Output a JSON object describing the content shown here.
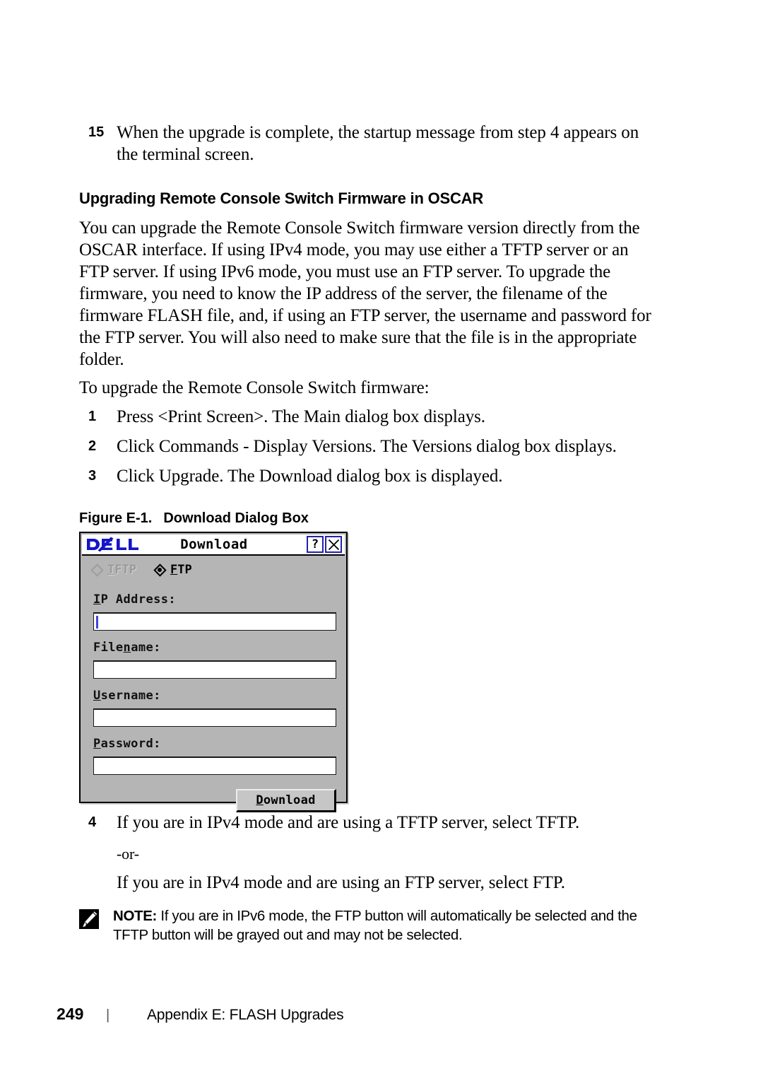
{
  "page": {
    "number": "249",
    "separator": "|",
    "footer_title": "Appendix E: FLASH Upgrades"
  },
  "step15": {
    "number": "15",
    "text": "When the upgrade is complete, the startup message from step 4 appears on the terminal screen."
  },
  "section": {
    "heading": "Upgrading Remote Console Switch Firmware in OSCAR",
    "paragraph": "You can upgrade the Remote Console Switch firmware version directly from the OSCAR interface. If using IPv4 mode, you may use either a TFTP server or an FTP server. If using IPv6 mode, you must use an FTP server. To upgrade the firmware, you need to know the IP address of the server, the filename of the firmware FLASH file, and, if using an FTP server, the username and password for the FTP server. You will also need to make sure that the file is in the appropriate folder.",
    "lead_in": "To upgrade the Remote Console Switch firmware:"
  },
  "steps": [
    {
      "number": "1",
      "parts": [
        {
          "t": "Press <Print Screen>. The ",
          "b": false
        },
        {
          "t": "Main",
          "b": true
        },
        {
          "t": " dialog box displays.",
          "b": false
        }
      ]
    },
    {
      "number": "2",
      "parts": [
        {
          "t": "Click ",
          "b": false
        },
        {
          "t": "Commands - Display Versions.",
          "b": true
        },
        {
          "t": " The ",
          "b": false
        },
        {
          "t": "Versions",
          "b": true
        },
        {
          "t": " dialog box displays.",
          "b": false
        }
      ]
    },
    {
      "number": "3",
      "parts": [
        {
          "t": "Click ",
          "b": false
        },
        {
          "t": "Upgrade.",
          "b": true
        },
        {
          "t": " The ",
          "b": false
        },
        {
          "t": "Download",
          "b": true
        },
        {
          "t": " dialog box is displayed.",
          "b": false
        }
      ]
    }
  ],
  "figure": {
    "label": "Figure E-1.",
    "title": "Download Dialog Box"
  },
  "dialog": {
    "brand": "DELL",
    "title": "Download",
    "help_button": "?",
    "close_button": "✕",
    "protocol": {
      "options": [
        {
          "label": "TFTP",
          "mnemonic": "T",
          "selected": false,
          "disabled": true
        },
        {
          "label": "FTP",
          "mnemonic": "F",
          "selected": true,
          "disabled": false
        }
      ]
    },
    "fields": [
      {
        "label": "IP Address:",
        "mnemonic_index": 0,
        "value": "",
        "has_caret": true
      },
      {
        "label": "Filename:",
        "mnemonic_index": 4,
        "value": "",
        "has_caret": false
      },
      {
        "label": "Username:",
        "mnemonic_index": 0,
        "value": "",
        "has_caret": false
      },
      {
        "label": "Password:",
        "mnemonic_index": 0,
        "value": "",
        "has_caret": false
      }
    ],
    "submit_label": "Download",
    "submit_mnemonic": "D",
    "colors": {
      "face": "#b5b5b5",
      "titlebar": "#ffffff",
      "brand_blue": "#1414c8",
      "caret_blue": "#4444dd",
      "button_face": "#c6c6c6",
      "disabled_text": "#9a9a9a"
    }
  },
  "step4": {
    "number": "4",
    "line1": "If you are in IPv4 mode and are using a TFTP server, select TFTP.",
    "or": "-or-",
    "line2": "If you are in IPv4 mode and are using an FTP server, select FTP."
  },
  "note": {
    "label": "NOTE:",
    "text": "If you are in IPv6 mode, the FTP button will automatically be selected and the TFTP button will be grayed out and may not be selected.",
    "icon": "pencil-note-icon"
  }
}
